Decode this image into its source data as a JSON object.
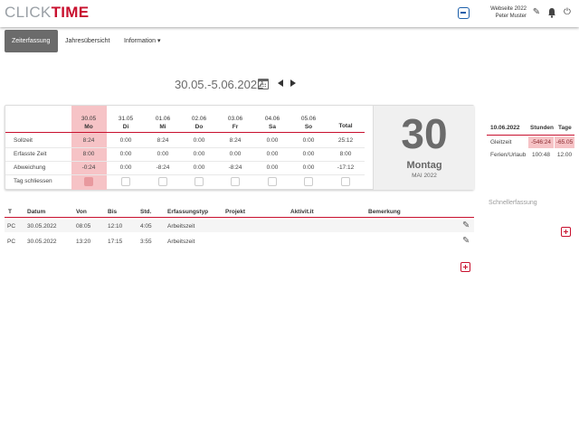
{
  "app": {
    "logo_part1": "CLICK",
    "logo_part2": "TIME"
  },
  "user": {
    "line1": "Webseite 2022",
    "line2": "Peter Muster"
  },
  "nav": {
    "tabs": [
      "Zeiterfassung",
      "Jahresübersicht",
      "Information"
    ],
    "dropdown_caret": "▾"
  },
  "date_range": "30.05.-5.06.2022",
  "week": {
    "days": [
      {
        "date": "30.05",
        "name": "Mo"
      },
      {
        "date": "31.05",
        "name": "Di"
      },
      {
        "date": "01.06",
        "name": "Mi"
      },
      {
        "date": "02.06",
        "name": "Do"
      },
      {
        "date": "03.06",
        "name": "Fr"
      },
      {
        "date": "04.06",
        "name": "Sa"
      },
      {
        "date": "05.06",
        "name": "So"
      }
    ],
    "total_label": "Total",
    "rows": [
      {
        "label": "Sollzeit",
        "values": [
          "8:24",
          "0:00",
          "8:24",
          "0:00",
          "8:24",
          "0:00",
          "0:00"
        ],
        "total": "25:12"
      },
      {
        "label": "Erfasste Zeit",
        "values": [
          "8:00",
          "0:00",
          "0:00",
          "0:00",
          "0:00",
          "0:00",
          "0:00"
        ],
        "total": "8:00"
      },
      {
        "label": "Abweichung",
        "values": [
          "-0:24",
          "0:00",
          "-8:24",
          "0:00",
          "-8:24",
          "0:00",
          "0:00"
        ],
        "total": "-17:12"
      }
    ],
    "close_label": "Tag schliessen"
  },
  "big_day": {
    "number": "30",
    "weekday": "Montag",
    "month": "MAI 2022"
  },
  "summary": {
    "date": "10.06.2022",
    "col_hours": "Stunden",
    "col_days": "Tage",
    "rows": [
      {
        "label": "Gleitzeit",
        "hours": "-546:24",
        "days": "-65.05"
      },
      {
        "label": "Ferien/Urlaub",
        "hours": "100:48",
        "days": "12.00"
      }
    ]
  },
  "quick_entry_label": "Schnellerfassung",
  "entries": {
    "headers": [
      "T",
      "Datum",
      "Von",
      "Bis",
      "Std.",
      "Erfassungstyp",
      "Projekt",
      "Aktivit.it",
      "Bemerkung"
    ],
    "rows": [
      {
        "t": "PC",
        "date": "30.05.2022",
        "from": "08:05",
        "to": "12:10",
        "hours": "4:05",
        "type": "Arbeitszeit"
      },
      {
        "t": "PC",
        "date": "30.05.2022",
        "from": "13:20",
        "to": "17:15",
        "hours": "3:55",
        "type": "Arbeitszeit"
      }
    ]
  },
  "icons": {
    "teamviewer": "teamviewer-icon",
    "edit": "✎",
    "bell": "bell-icon",
    "power": "⏻",
    "calendar": "calendar-icon",
    "prev": "triangle-left-icon",
    "next": "triangle-right-icon",
    "add": "plus-square-icon"
  },
  "colors": {
    "brand_red": "#c8102e",
    "highlight_pink": "#f6c3c6",
    "active_tab": "#6b6b6b"
  }
}
